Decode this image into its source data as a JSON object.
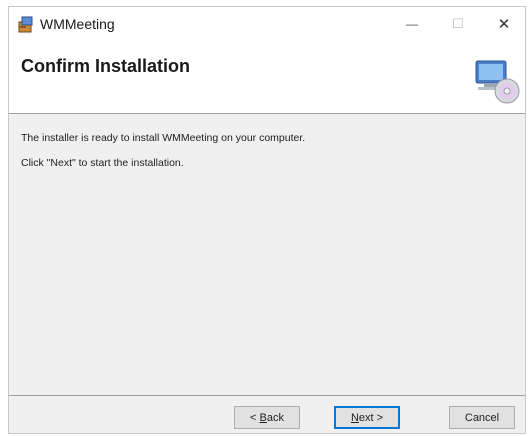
{
  "window": {
    "title": "WMMeeting",
    "controls": {
      "minimize": "—",
      "maximize": "☐",
      "close": "✕"
    }
  },
  "header": {
    "title": "Confirm Installation",
    "graphic": "installer-computer-cd-icon"
  },
  "body": {
    "line1": "The installer is ready to install WMMeeting on your computer.",
    "line2": "Click \"Next\" to start the installation."
  },
  "buttons": {
    "back": {
      "prefix": "< ",
      "mnemonic": "B",
      "rest": "ack"
    },
    "next": {
      "mnemonic": "N",
      "rest": "ext",
      "suffix": " >"
    },
    "cancel": "Cancel"
  },
  "colors": {
    "default_button_border": "#0078d7",
    "background": "#f0f0f0"
  }
}
